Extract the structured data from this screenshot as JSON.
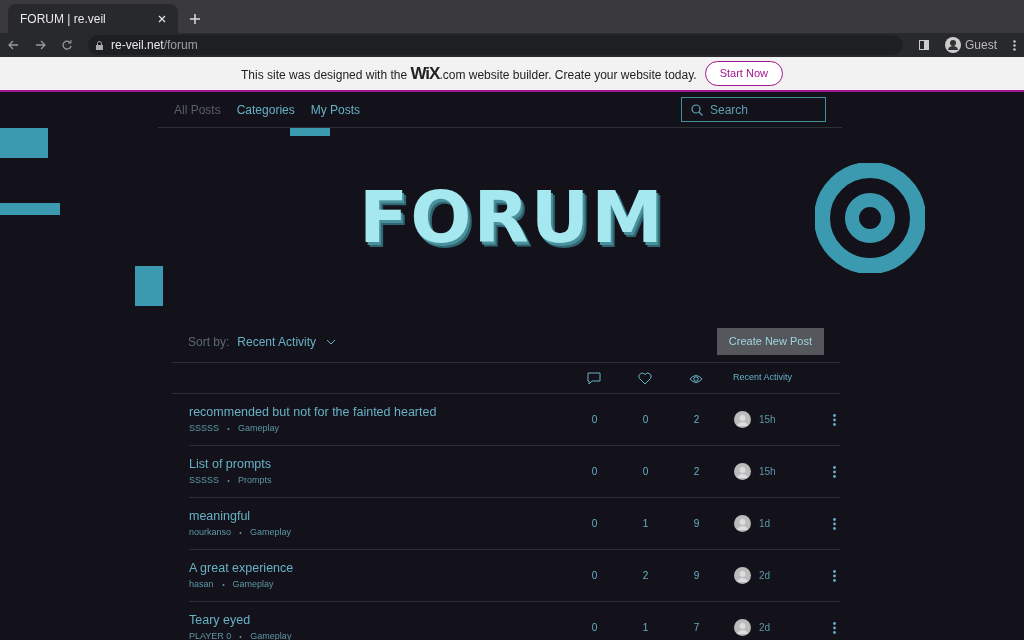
{
  "browser": {
    "tab_title": "FORUM | re.veil",
    "url_host": "re-veil.net",
    "url_path": "/forum",
    "profile": "Guest"
  },
  "wix_banner": {
    "text_before": "This site was designed with the",
    "logo": "WiX",
    "logo_suffix": ".com",
    "text_after": "website builder. Create your website today.",
    "button": "Start Now"
  },
  "forum_nav": {
    "tabs": [
      {
        "label": "All Posts",
        "selected": true
      },
      {
        "label": "Categories",
        "selected": false
      },
      {
        "label": "My Posts",
        "selected": false
      }
    ],
    "search": {
      "placeholder": "Search"
    }
  },
  "hero": {
    "title": "FORUM"
  },
  "toolbar": {
    "sort_label": "Sort by:",
    "sort_value": "Recent Activity",
    "create_button": "Create New Post"
  },
  "table": {
    "activity_header": "Recent Activity",
    "rows": [
      {
        "title": "recommended but not for the fainted hearted",
        "author": "SSSSS",
        "category": "Gameplay",
        "comments": "0",
        "likes": "0",
        "views": "2",
        "time": "15h"
      },
      {
        "title": "List of prompts",
        "author": "SSSSS",
        "category": "Prompts",
        "comments": "0",
        "likes": "0",
        "views": "2",
        "time": "15h"
      },
      {
        "title": "meaningful",
        "author": "nourkanso",
        "category": "Gameplay",
        "comments": "0",
        "likes": "1",
        "views": "9",
        "time": "1d"
      },
      {
        "title": "A great experience",
        "author": "hasan",
        "category": "Gameplay",
        "comments": "0",
        "likes": "2",
        "views": "9",
        "time": "2d"
      },
      {
        "title": "Teary eyed",
        "author": "PLAYER 0",
        "category": "Gameplay",
        "comments": "0",
        "likes": "1",
        "views": "7",
        "time": "2d"
      }
    ]
  }
}
